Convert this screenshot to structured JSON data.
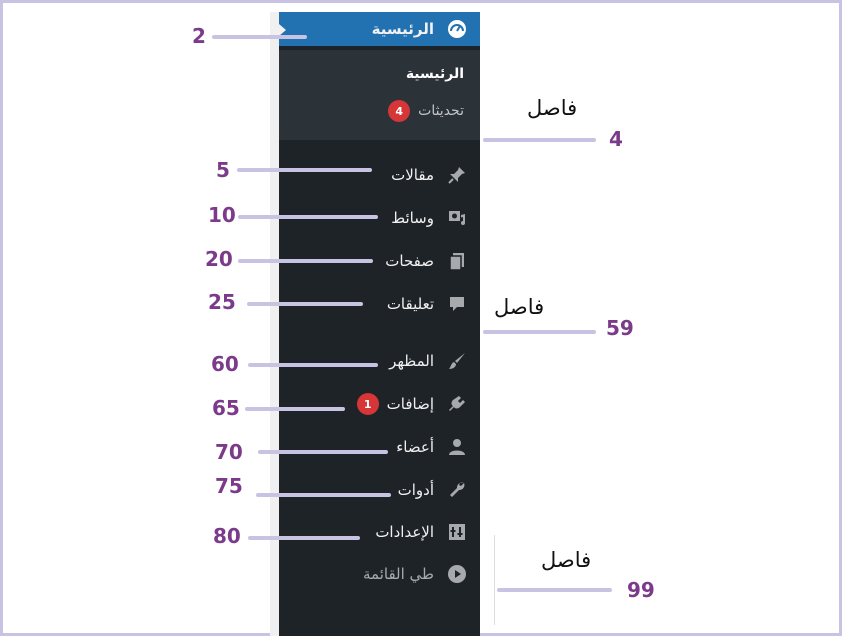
{
  "menu": {
    "top": {
      "label": "الرئيسية",
      "icon": "dashboard-gauge-icon"
    },
    "submenu": {
      "home_label": "الرئيسية",
      "updates_label": "تحديثات",
      "updates_badge": "4"
    },
    "items": [
      {
        "label": "مقالات",
        "icon": "pushpin-icon"
      },
      {
        "label": "وسائط",
        "icon": "media-icon"
      },
      {
        "label": "صفحات",
        "icon": "pages-icon"
      },
      {
        "label": "تعليقات",
        "icon": "comment-icon"
      },
      {
        "label": "المظهر",
        "icon": "paintbrush-icon"
      },
      {
        "label": "إضافات",
        "icon": "plugin-icon",
        "badge": "1"
      },
      {
        "label": "أعضاء",
        "icon": "user-icon"
      },
      {
        "label": "أدوات",
        "icon": "wrench-icon"
      },
      {
        "label": "الإعدادات",
        "icon": "settings-sliders-icon"
      },
      {
        "label": "طي القائمة",
        "icon": "collapse-play-icon"
      }
    ]
  },
  "annotations": {
    "positions": [
      "2",
      "4",
      "5",
      "10",
      "20",
      "25",
      "59",
      "60",
      "65",
      "70",
      "75",
      "80",
      "99"
    ],
    "separator_label": "فاصل"
  },
  "colors": {
    "sidebar_bg": "#1d2327",
    "submenu_bg": "#2c3338",
    "active_bg": "#2271b1",
    "badge_bg": "#d63638",
    "annotation_number": "#7b3a8a",
    "annotation_line": "#c9c3e3"
  }
}
